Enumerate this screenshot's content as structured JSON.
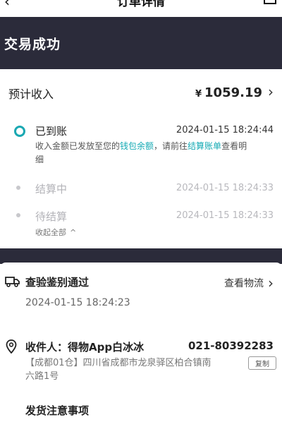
{
  "header": {
    "title": "订单详情"
  },
  "status": {
    "text": "交易成功"
  },
  "income": {
    "label": "预计收入",
    "currency": "¥",
    "amount": "1059.19",
    "chevron": "›"
  },
  "timeline": {
    "steps": [
      {
        "label": "已到账",
        "time": "2024-01-15 18:24:44"
      },
      {
        "label": "结算中",
        "time": "2024-01-15 18:24:33"
      },
      {
        "label": "待结算",
        "time": "2024-01-15 18:24:33"
      }
    ],
    "note_part1": "收入金额已发放至您的",
    "note_link1": "钱包余额",
    "note_part2": "，请前往",
    "note_link2": "结算账单",
    "note_part3": "查看明",
    "note_line2": "细",
    "collapse": "收起全部",
    "collapse_arrow": "^"
  },
  "inspection": {
    "label": "查验鉴别通过",
    "logistics": "查看物流",
    "chevron": "›",
    "time": "2024-01-15 18:24:23"
  },
  "recipient": {
    "label": "收件人：得物App白冰冰",
    "phone": "021-80392283",
    "address_line1": "【成都01仓】四川省成都市龙泉驿区柏合镇南",
    "address_line2": "六路1号",
    "copy": "复制"
  },
  "shipping": {
    "title": "发货注意事项"
  },
  "colors": {
    "accent": "#1aa8b2",
    "dark_band": "#2b2b3a"
  }
}
